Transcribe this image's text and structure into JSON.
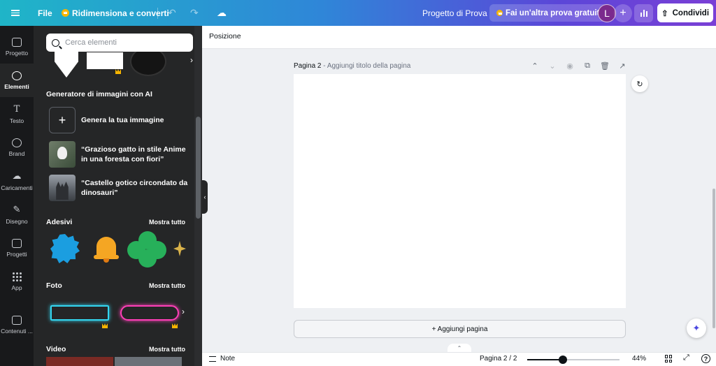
{
  "topbar": {
    "file_label": "File",
    "resize_label": "Ridimensiona e converti",
    "project_title": "Progetto di Prova",
    "trial_label": "Fai un'altra prova gratuita",
    "avatar_initial": "L",
    "share_label": "Condividi"
  },
  "rail": {
    "items": [
      {
        "label": "Progetto",
        "icon": "layout-icon"
      },
      {
        "label": "Elementi",
        "icon": "elements-icon"
      },
      {
        "label": "Testo",
        "icon": "text-icon"
      },
      {
        "label": "Brand",
        "icon": "brand-icon"
      },
      {
        "label": "Caricamenti",
        "icon": "upload-icon"
      },
      {
        "label": "Disegno",
        "icon": "draw-icon"
      },
      {
        "label": "Progetti",
        "icon": "folder-icon"
      },
      {
        "label": "App",
        "icon": "apps-icon"
      },
      {
        "label": "Contenuti ...",
        "icon": "magic-media-icon"
      }
    ]
  },
  "panel": {
    "search_placeholder": "Cerca elementi",
    "ai_section_title": "Generatore di immagini con AI",
    "ai_items": [
      {
        "label": "Genera la tua immagine"
      },
      {
        "label_line1": "“Grazioso gatto in stile Anime",
        "label_line2": "in una foresta con fiori”"
      },
      {
        "label_line1": "“Castello gotico circondato da",
        "label_line2": "dinosauri”"
      }
    ],
    "stickers_title": "Adesivi",
    "photos_title": "Foto",
    "videos_title": "Video",
    "show_all": "Mostra tutto"
  },
  "context_toolbar": {
    "position_label": "Posizione"
  },
  "canvas": {
    "page_label": "Pagina 2",
    "page_title_placeholder": "Aggiungi titolo della pagina",
    "add_page_label": "+ Aggiungi pagina"
  },
  "bottombar": {
    "notes_label": "Note",
    "page_indicator": "Pagina 2 / 2",
    "zoom_level": "44%",
    "zoom_fraction": 0.39
  },
  "colors": {
    "accent": "#7a3fd6",
    "topbar_start": "#1fb5c8",
    "panel_bg": "#252627",
    "rail_bg": "#18191b"
  }
}
